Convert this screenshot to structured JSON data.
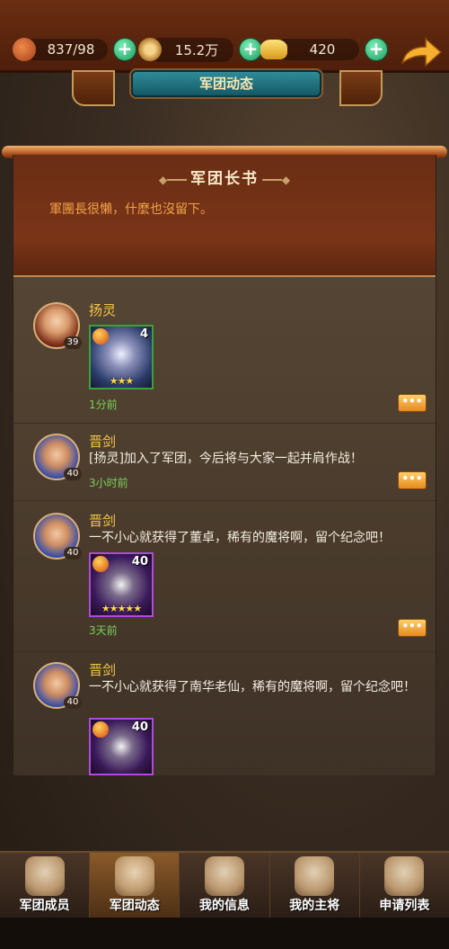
{
  "resources": [
    {
      "icon": "meat-icon",
      "value": "837/98"
    },
    {
      "icon": "coin-icon",
      "value": "15.2万"
    },
    {
      "icon": "gold-ingot-icon",
      "value": "420"
    }
  ],
  "header": {
    "title": "军团动态"
  },
  "notice": {
    "title": "军团长书",
    "text": "軍團長很懶，什麼也沒留下。"
  },
  "feed": [
    {
      "name": "扬灵",
      "level": "39",
      "message": "",
      "card": {
        "count": "4",
        "stars": "★★★"
      },
      "time": "1分前"
    },
    {
      "name": "晋剑",
      "level": "40",
      "message": "[扬灵]加入了军团，今后将与大家一起并肩作战！",
      "time": "3小时前"
    },
    {
      "name": "晋剑",
      "level": "40",
      "message": "一不小心就获得了董卓，稀有的魔将啊，留个纪念吧！",
      "card": {
        "count": "40",
        "stars": "★★★★★"
      },
      "time": "3天前"
    },
    {
      "name": "晋剑",
      "level": "40",
      "message": "一不小心就获得了南华老仙，稀有的魔将啊，留个纪念吧！",
      "card": {
        "count": "40",
        "stars": ""
      },
      "time": ""
    }
  ],
  "tabs": [
    {
      "label": "军团成员",
      "active": false
    },
    {
      "label": "军团动态",
      "active": true
    },
    {
      "label": "我的信息",
      "active": false
    },
    {
      "label": "我的主将",
      "active": false
    },
    {
      "label": "申请列表",
      "active": false
    }
  ],
  "colors": {
    "name": "#f4c64a",
    "time": "#7bd05a",
    "notice_text": "#f0a24a",
    "plus": "#1f9a60"
  }
}
